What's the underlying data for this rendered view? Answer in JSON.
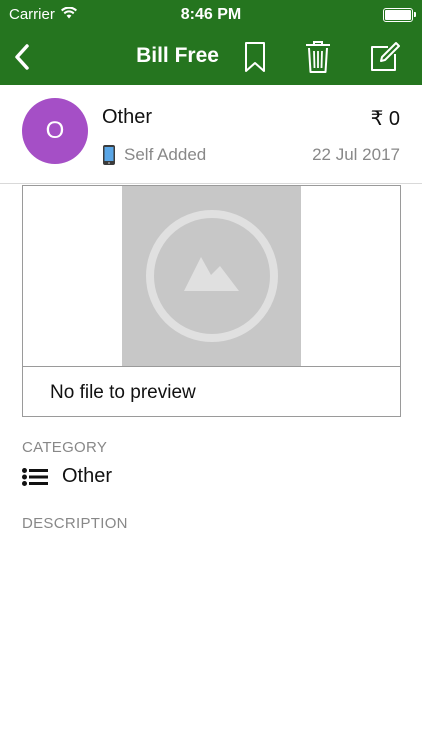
{
  "status_bar": {
    "carrier": "Carrier",
    "time": "8:46 PM"
  },
  "nav": {
    "title": "Bill Free",
    "icons": [
      "back-chevron-icon",
      "bookmark-icon",
      "trash-icon",
      "edit-icon"
    ]
  },
  "bill": {
    "avatar_letter": "O",
    "name": "Other",
    "amount": "₹ 0",
    "source": "Self Added",
    "date": "22 Jul 2017"
  },
  "preview": {
    "message": "No file to preview"
  },
  "category": {
    "label": "CATEGORY",
    "value": "Other"
  },
  "description": {
    "label": "DESCRIPTION"
  },
  "colors": {
    "header_green": "#25751f",
    "avatar_purple": "#a54fc6",
    "muted_text": "#888888"
  }
}
